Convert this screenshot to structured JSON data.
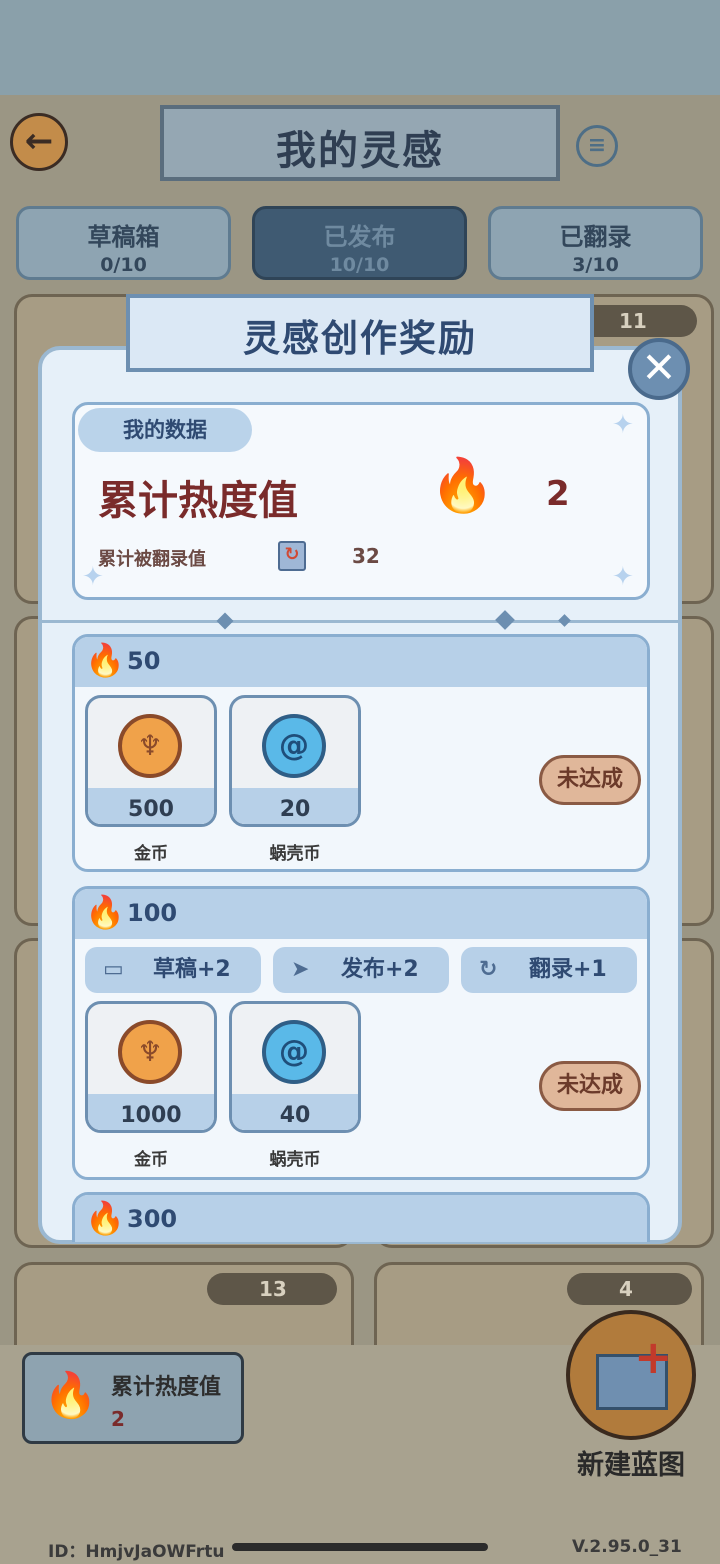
{
  "header": {
    "title": "我的灵感",
    "back_icon": "←",
    "info_icon": "≡"
  },
  "tabs": [
    {
      "label": "草稿箱",
      "count": "0/10"
    },
    {
      "label": "已发布",
      "count": "10/10"
    },
    {
      "label": "已翻录",
      "count": "3/10"
    }
  ],
  "background_cards": [
    {
      "views": "11"
    },
    {
      "views": "13"
    },
    {
      "views": "4"
    }
  ],
  "bottom_bar": {
    "heat_label": "累计热度值",
    "heat_value": "2",
    "flame_icon": "🔥"
  },
  "new_blueprint": {
    "label": "新建蓝图",
    "plus": "+"
  },
  "footer": {
    "id": "ID：HmjvJaOWFrtu",
    "version": "V.2.95.0_31"
  },
  "modal": {
    "title": "灵感创作奖励",
    "close_icon": "✕",
    "my_data": {
      "pill": "我的数据",
      "heat_label": "累计热度值",
      "heat_value": "2",
      "copy_label": "累计被翻录值",
      "copy_value": "32",
      "flame_icon": "🔥",
      "copy_icon": "↻",
      "sparkle": "✦"
    },
    "tiers": [
      {
        "threshold": "50",
        "perks": [],
        "items": [
          {
            "qty": "500",
            "name": "金币",
            "icon": "gold-coin"
          },
          {
            "qty": "20",
            "name": "蜗壳币",
            "icon": "shell-coin"
          }
        ],
        "status": "未达成"
      },
      {
        "threshold": "100",
        "perks": [
          {
            "icon": "folder-icon",
            "glyph": "▭",
            "label": "草稿+2"
          },
          {
            "icon": "send-icon",
            "glyph": "➤",
            "label": "发布+2"
          },
          {
            "icon": "copy-icon",
            "glyph": "↻",
            "label": "翻录+1"
          }
        ],
        "items": [
          {
            "qty": "1000",
            "name": "金币",
            "icon": "gold-coin"
          },
          {
            "qty": "40",
            "name": "蜗壳币",
            "icon": "shell-coin"
          }
        ],
        "status": "未达成"
      },
      {
        "threshold": "300"
      }
    ],
    "coin_glyphs": {
      "gold": "♆",
      "blue": "@"
    }
  }
}
